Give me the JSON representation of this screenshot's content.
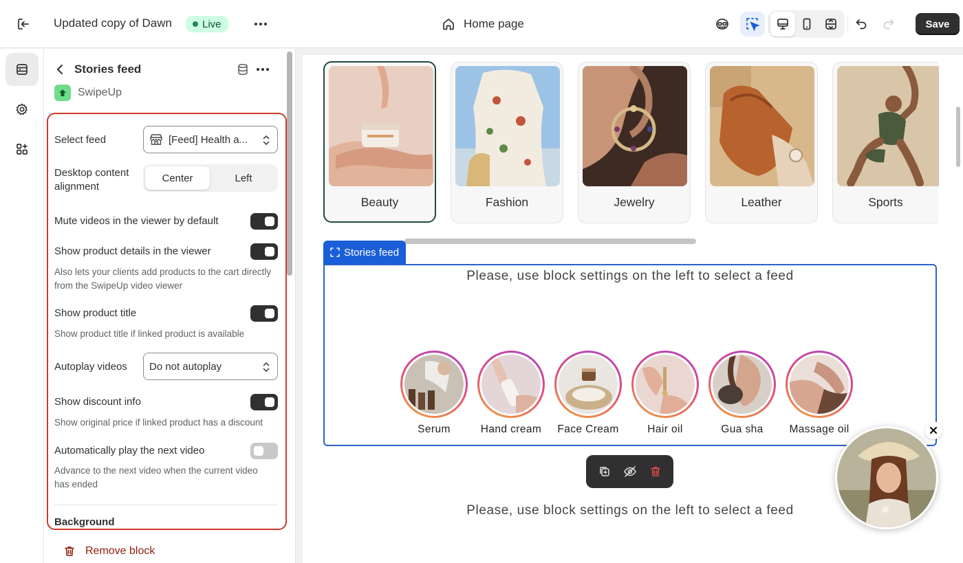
{
  "topbar": {
    "theme_name": "Updated copy of Dawn",
    "status_badge": "Live",
    "page_selector": "Home page",
    "save_label": "Save"
  },
  "panel": {
    "title": "Stories feed",
    "app_name": "SwipeUp",
    "select_feed_label": "Select feed",
    "select_feed_value": "[Feed] Health a...",
    "alignment_label": "Desktop content alignment",
    "alignment_options": [
      "Center",
      "Left"
    ],
    "alignment_selected": "Center",
    "mute_label": "Mute videos in the viewer by default",
    "mute_on": true,
    "product_details_label": "Show product details in the viewer",
    "product_details_on": true,
    "product_details_help": "Also lets your clients add products to the cart directly from the SwipeUp video viewer",
    "product_title_label": "Show product title",
    "product_title_on": true,
    "product_title_help": "Show product title if linked product is available",
    "autoplay_label": "Autoplay videos",
    "autoplay_value": "Do not autoplay",
    "discount_label": "Show discount info",
    "discount_on": true,
    "discount_help": "Show original price if linked product has a discount",
    "autonext_label": "Automatically play the next video",
    "autonext_on": false,
    "autonext_help": "Advance to the next video when the current video has ended",
    "background_heading": "Background",
    "remove_label": "Remove block"
  },
  "preview": {
    "categories": [
      "Beauty",
      "Fashion",
      "Jewelry",
      "Leather",
      "Sports"
    ],
    "selected_category": "Beauty",
    "block_tag": "Stories feed",
    "message": "Please, use block settings on the left to select a feed",
    "stories": [
      "Serum",
      "Hand cream",
      "Face Cream",
      "Hair oil",
      "Gua sha",
      "Massage oil"
    ]
  },
  "colors": {
    "accent_blue": "#2a62c8",
    "highlight_red": "#d03a2b",
    "live_green": "#29845a"
  }
}
